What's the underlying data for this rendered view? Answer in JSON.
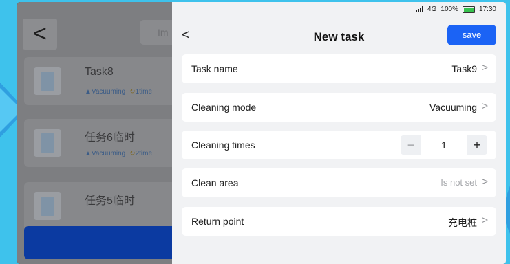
{
  "status_bar": {
    "network": "4G",
    "battery": "100%",
    "time": "17:30"
  },
  "background": {
    "back_glyph": "<",
    "search_hint": "Im",
    "tasks": [
      {
        "name": "Task8",
        "mode": "Vacuuming",
        "freq": "1time"
      },
      {
        "name": "任务6临时",
        "mode": "Vacuuming",
        "freq": "2time"
      },
      {
        "name": "任务5临时",
        "mode": "",
        "freq": ""
      }
    ]
  },
  "header": {
    "back_glyph": "<",
    "title": "New task",
    "save_label": "save"
  },
  "form": {
    "task_name": {
      "label": "Task name",
      "value": "Task9"
    },
    "cleaning_mode": {
      "label": "Cleaning mode",
      "value": "Vacuuming"
    },
    "cleaning_times": {
      "label": "Cleaning times",
      "value": "1",
      "minus": "−",
      "plus": "+"
    },
    "clean_area": {
      "label": "Clean area",
      "value": "Is not set"
    },
    "return_point": {
      "label": "Return point",
      "value": "充电桩"
    },
    "chevron": ">"
  },
  "colors": {
    "accent": "#1b63f5",
    "frame_bg": "#3ec2ec"
  }
}
